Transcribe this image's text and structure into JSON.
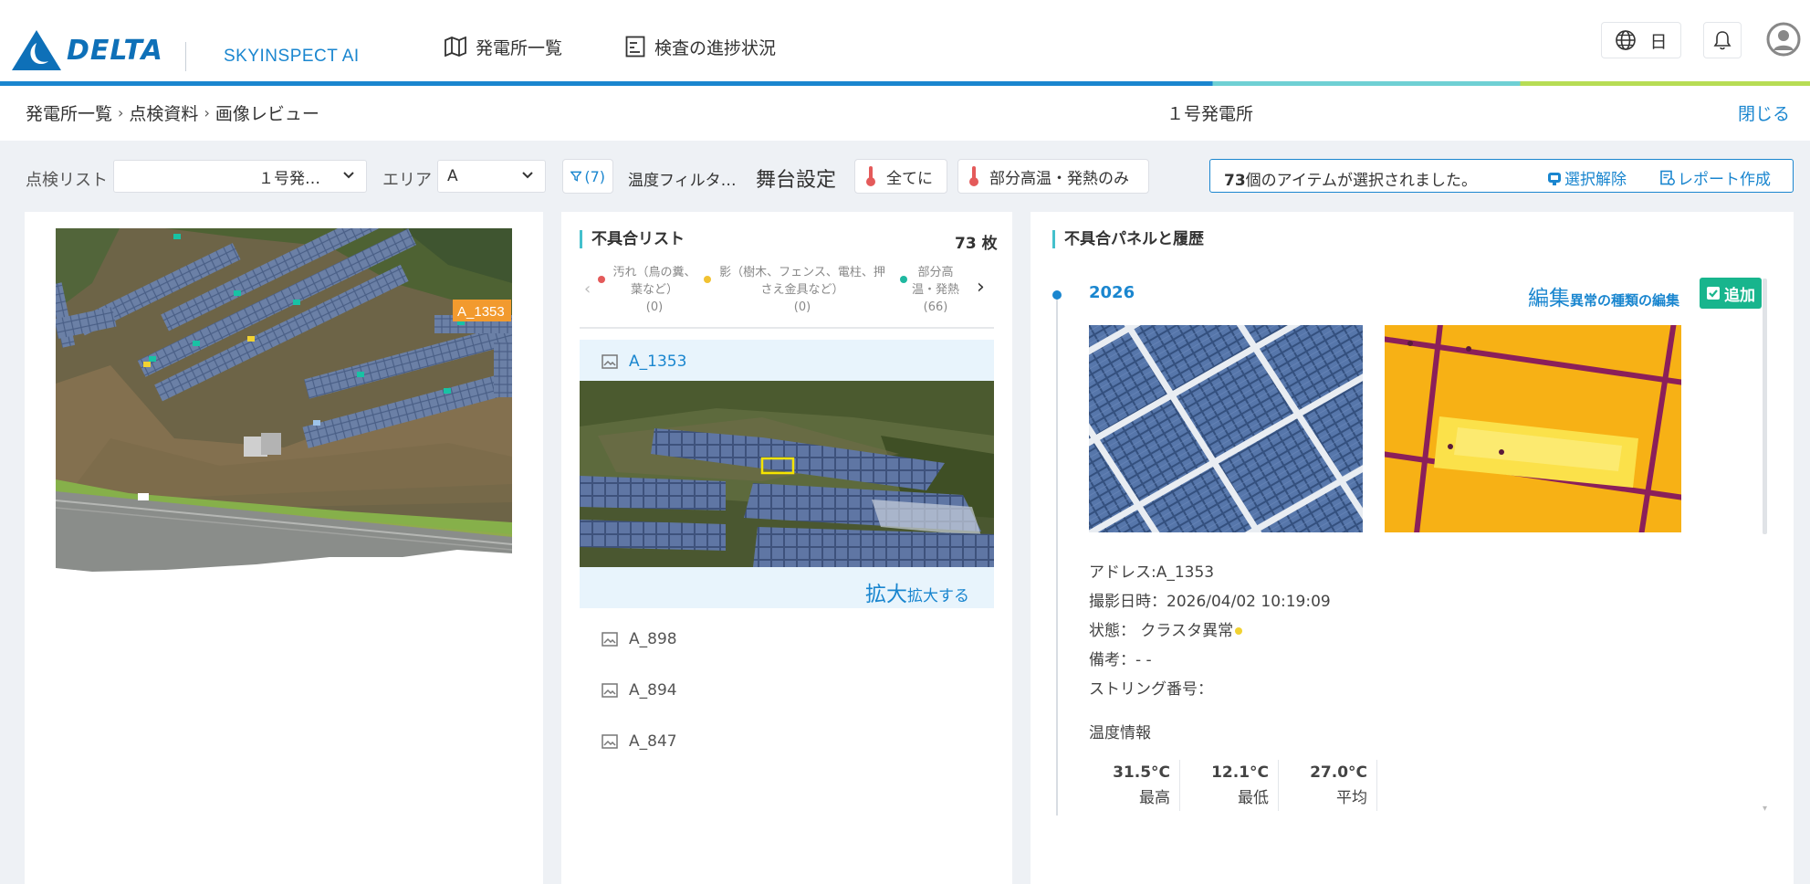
{
  "header": {
    "logo_text": "DELTA",
    "app_name": "SKYINSPECT AI",
    "nav": [
      {
        "label": "発電所一覧",
        "icon": "map-icon"
      },
      {
        "label": "検査の進捗状況",
        "icon": "progress-report-icon"
      }
    ],
    "language": "日"
  },
  "breadcrumb": [
    "発電所一覧",
    "点検資料",
    "画像レビュー"
  ],
  "plant_title": "１号発電所",
  "close_label": "閉じる",
  "filters": {
    "inspection_list_label": "点検リスト",
    "inspection_list_value": "１号発…",
    "area_label": "エリア",
    "area_value": "A",
    "filter_count": "(7)",
    "temp_filter_label": "温度フィルタ…",
    "stage_label": "舞台設定",
    "chip_all": "全てに",
    "chip_hot": "部分高温・発熱のみ"
  },
  "selection": {
    "count": "73",
    "message": "個のアイテムが選択されました。",
    "deselect": "選択解除",
    "report": "レポート作成"
  },
  "defect_list": {
    "title": "不具合リスト",
    "count": "73 枚",
    "legend": [
      {
        "line1": "汚れ（鳥の糞、",
        "line2": "葉など）",
        "count": "(0)",
        "color": "#e45a5a"
      },
      {
        "line1": "影（樹木、フェンス、電柱、押",
        "line2": "さえ金具など）",
        "count": "(0)",
        "color": "#f1c232"
      },
      {
        "line1": "部分高",
        "line2": "温・発熱",
        "count": "(66)",
        "color": "#1fb8a0"
      }
    ],
    "items": [
      "A_1353",
      "A_898",
      "A_894",
      "A_847"
    ],
    "expand_big": "拡大",
    "expand_small": "拡大する"
  },
  "map": {
    "marker_label": "A_1353"
  },
  "detail": {
    "title": "不具合パネルと履歴",
    "year": "2026",
    "edit_big": "編集",
    "edit_small": "異常の種類の編集",
    "add": "追加",
    "address": "アドレス:A_1353",
    "shot_time": "撮影日時：2026/04/02 10:19:09",
    "status": "状態： クラスタ異常",
    "status_color": "#f1d232",
    "note": "備考：- -",
    "string_no": "ストリング番号：",
    "temp_title": "温度情報",
    "temps": [
      {
        "value": "31.5°C",
        "label": "最高"
      },
      {
        "value": "12.1°C",
        "label": "最低"
      },
      {
        "value": "27.0°C",
        "label": "平均"
      }
    ]
  },
  "colors": {
    "accent": "#1a86cf",
    "teal": "#44c0cc",
    "add_green": "#18b58d",
    "marker_orange": "#f29a2e"
  }
}
